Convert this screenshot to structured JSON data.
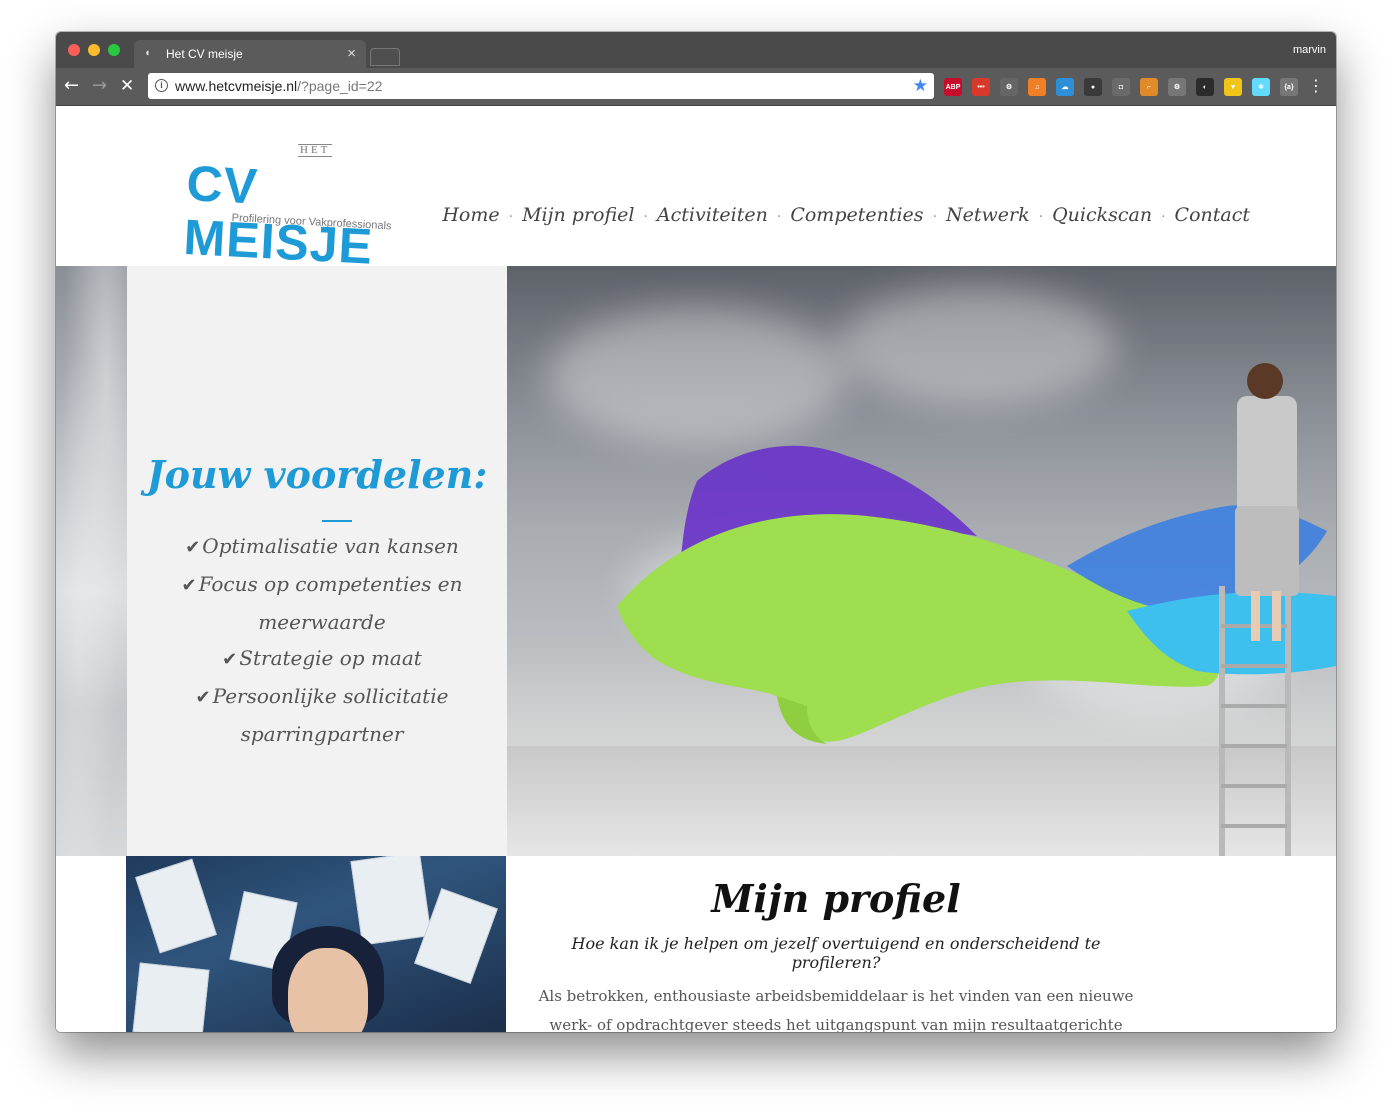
{
  "browser": {
    "tab_title": "Het CV meisje",
    "tab_close": "×",
    "profile_name": "marvin",
    "url_host": "www.hetcvmeisje.nl",
    "url_path": "/?page_id=22",
    "extensions": [
      {
        "name": "adblock-plus-icon",
        "label": "ABP",
        "color": "#c70d2c"
      },
      {
        "name": "extension-red-icon",
        "label": "•••",
        "color": "#d9392b"
      },
      {
        "name": "gear-extension-icon",
        "label": "⚙",
        "color": "#666666"
      },
      {
        "name": "music-extension-icon",
        "label": "♫",
        "color": "#f07f26"
      },
      {
        "name": "weather-extension-icon",
        "label": "☁",
        "color": "#2d8fd5"
      },
      {
        "name": "spy-extension-icon",
        "label": "●",
        "color": "#3a3a3a"
      },
      {
        "name": "camera-extension-icon",
        "label": "◘",
        "color": "#6a6a6a"
      },
      {
        "name": "pin-extension-icon",
        "label": "⌐",
        "color": "#e08a2a"
      },
      {
        "name": "settings-extension-icon",
        "label": "⚙",
        "color": "#777777"
      },
      {
        "name": "circle-extension-icon",
        "label": "◐",
        "color": "#ffffff"
      },
      {
        "name": "shield-extension-icon",
        "label": "▼",
        "color": "#f0c419"
      },
      {
        "name": "react-extension-icon",
        "label": "⚛",
        "color": "#61dafb"
      },
      {
        "name": "bracket-extension-icon",
        "label": "{a}",
        "color": "#777777"
      }
    ]
  },
  "site": {
    "logo_het": "HET",
    "logo_main": "CV MEISJE",
    "logo_tagline": "Profilering voor Vakprofessionals",
    "nav": [
      "Home",
      "Mijn profiel",
      "Activiteiten",
      "Competenties",
      "Netwerk",
      "Quickscan",
      "Contact"
    ],
    "nav_separator": "·"
  },
  "hero": {
    "title": "Jouw voordelen:",
    "benefits": [
      "Optimalisatie van kansen",
      "Focus op competenties en meerwaarde",
      "Strategie op maat",
      "Persoonlijke sollicitatie sparringpartner"
    ],
    "check_glyph": "✔"
  },
  "profile_section": {
    "title": "Mijn profiel",
    "subtitle": "Hoe kan ik je helpen om jezelf overtuigend en onderscheidend te profileren?",
    "body": "Als betrokken, enthousiaste arbeidsbemiddelaar is het vinden van een nieuwe werk- of opdrachtgever steeds het uitgangspunt van mijn resultaatgerichte aanpak. Door"
  },
  "colors": {
    "brand_blue": "#1e9bd7",
    "nav_text": "#444444",
    "panel_bg": "#f2f2f2"
  }
}
